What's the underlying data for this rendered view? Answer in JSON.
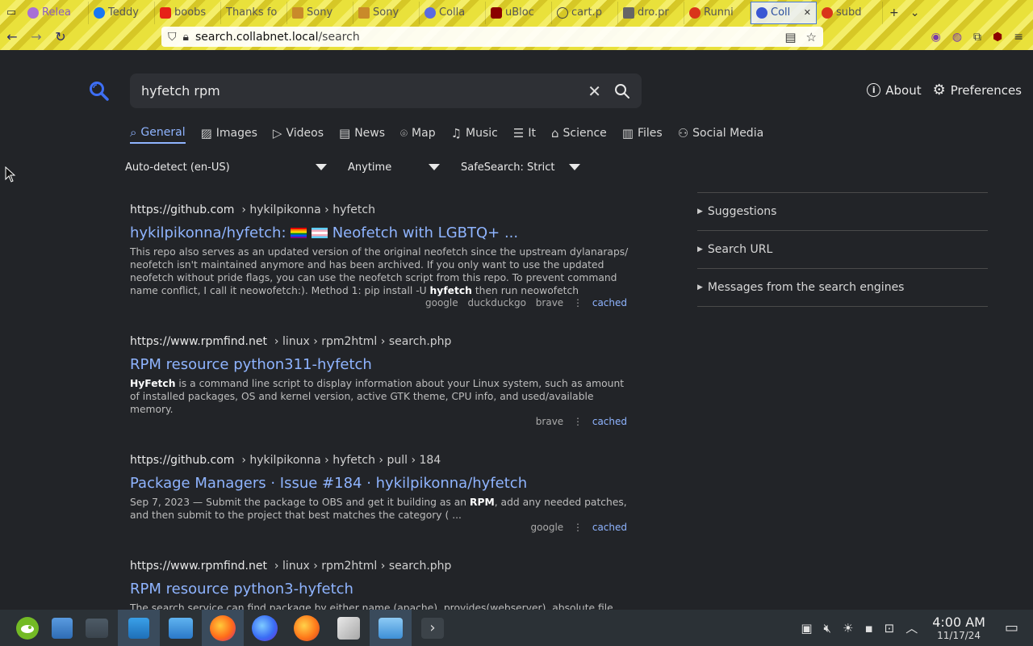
{
  "browser": {
    "tabs": [
      {
        "label": "Relea",
        "color": "#a86fd6",
        "active": false
      },
      {
        "label": "Teddy",
        "color": "#1877f2",
        "active": false
      },
      {
        "label": "boobs",
        "color": "#e62117",
        "active": false
      },
      {
        "label": "Thanks fo",
        "color": "#888888",
        "active": false
      },
      {
        "label": "Sony",
        "color": "#c98a2a",
        "active": false
      },
      {
        "label": "Sony",
        "color": "#c98a2a",
        "active": false
      },
      {
        "label": "Colla",
        "color": "#5a6be0",
        "active": false
      },
      {
        "label": "uBloc",
        "color": "#8b0000",
        "active": false
      },
      {
        "label": "cart.p",
        "color": "#444444",
        "active": false
      },
      {
        "label": "dro.pr",
        "color": "#666666",
        "active": false
      },
      {
        "label": "Runni",
        "color": "#d9351a",
        "active": false
      },
      {
        "label": "Coll",
        "color": "#3a57d4",
        "active": true
      },
      {
        "label": "subd",
        "color": "#d9351a",
        "active": false
      }
    ],
    "url_host": "search.collabnet.local",
    "url_path": "/search"
  },
  "search": {
    "query": "hyfetch rpm",
    "about_label": "About",
    "preferences_label": "Preferences"
  },
  "categories": [
    {
      "label": "General",
      "icon": "search-icon",
      "active": true
    },
    {
      "label": "Images",
      "icon": "image-icon",
      "active": false
    },
    {
      "label": "Videos",
      "icon": "play-icon",
      "active": false
    },
    {
      "label": "News",
      "icon": "newspaper-icon",
      "active": false
    },
    {
      "label": "Map",
      "icon": "map-pin-icon",
      "active": false
    },
    {
      "label": "Music",
      "icon": "music-icon",
      "active": false
    },
    {
      "label": "It",
      "icon": "layers-icon",
      "active": false
    },
    {
      "label": "Science",
      "icon": "graduation-icon",
      "active": false
    },
    {
      "label": "Files",
      "icon": "files-icon",
      "active": false
    },
    {
      "label": "Social Media",
      "icon": "people-icon",
      "active": false
    }
  ],
  "filters": {
    "language": "Auto-detect (en-US)",
    "time": "Anytime",
    "safesearch": "SafeSearch: Strict"
  },
  "results": [
    {
      "host": "https://github.com",
      "crumbs": "› hykilpikonna › hyfetch",
      "title_pre": "hykilpikonna/hyfetch: ",
      "title_post": " Neofetch with LGBTQ+ ...",
      "snippet_pre": "This repo also serves as an updated version of the original neofetch since the upstream dylanaraps/ neofetch isn't maintained anymore and has been archived. If you only want to use the updated neofetch without pride flags, you can use the neofetch script from this repo. To prevent command name conflict, I call it neowofetch:). Method 1: pip install -U ",
      "snippet_bold": "hyfetch",
      "snippet_post": " then run neowofetch",
      "engines": [
        "google",
        "duckduckgo",
        "brave"
      ],
      "cached": "cached"
    },
    {
      "host": "https://www.rpmfind.net",
      "crumbs": "› linux › rpm2html › search.php",
      "title": "RPM resource python311-hyfetch",
      "snippet_bold": "HyFetch",
      "snippet_post": " is a command line script to display information about your Linux system, such as amount of installed packages, OS and kernel version, active GTK theme, CPU info, and used/available memory.",
      "engines": [
        "brave"
      ],
      "cached": "cached"
    },
    {
      "host": "https://github.com",
      "crumbs": "› hykilpikonna › hyfetch › pull › 184",
      "title": "Package Managers · Issue #184 · hykilpikonna/hyfetch",
      "snippet_pre": "Sep 7, 2023 — Submit the package to OBS and get it building as an ",
      "snippet_bold": "RPM",
      "snippet_post": ", add any needed patches, and then submit to the project that best matches the category ( ...",
      "engines": [
        "google"
      ],
      "cached": "cached"
    },
    {
      "host": "https://www.rpmfind.net",
      "crumbs": "› linux › rpm2html › search.php",
      "title": "RPM resource python3-hyfetch",
      "snippet": "The search service can find package by either name (apache), provides(webserver), absolute file names (/ usr/bin/apache), binaries (gprof) or shared libraries (libXm.so.2) in standard path. It does not support"
    }
  ],
  "sidebar": {
    "items": [
      "Suggestions",
      "Search URL",
      "Messages from the search engines"
    ]
  },
  "taskbar": {
    "time": "4:00 AM",
    "date": "11/17/24"
  }
}
